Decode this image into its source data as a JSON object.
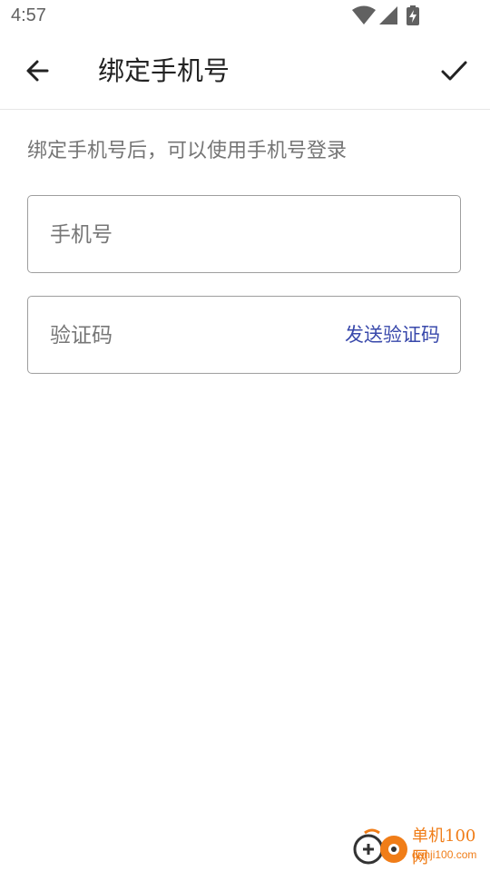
{
  "status_bar": {
    "time": "4:57",
    "icons": [
      "wifi-icon",
      "cell-signal-icon",
      "battery-charging-icon"
    ]
  },
  "app_bar": {
    "title": "绑定手机号",
    "back_icon": "arrow-back-icon",
    "confirm_icon": "check-icon"
  },
  "hint": "绑定手机号后，可以使用手机号登录",
  "phone_field": {
    "placeholder": "手机号",
    "value": ""
  },
  "code_field": {
    "placeholder": "验证码",
    "value": "",
    "send_label": "发送验证码"
  },
  "colors": {
    "accent": "#3949ab",
    "text": "#222222",
    "hint": "#757575",
    "border": "#9e9e9e",
    "watermark": "#f07d18"
  },
  "watermark": {
    "name": "单机100网",
    "url": "danji100.com"
  }
}
